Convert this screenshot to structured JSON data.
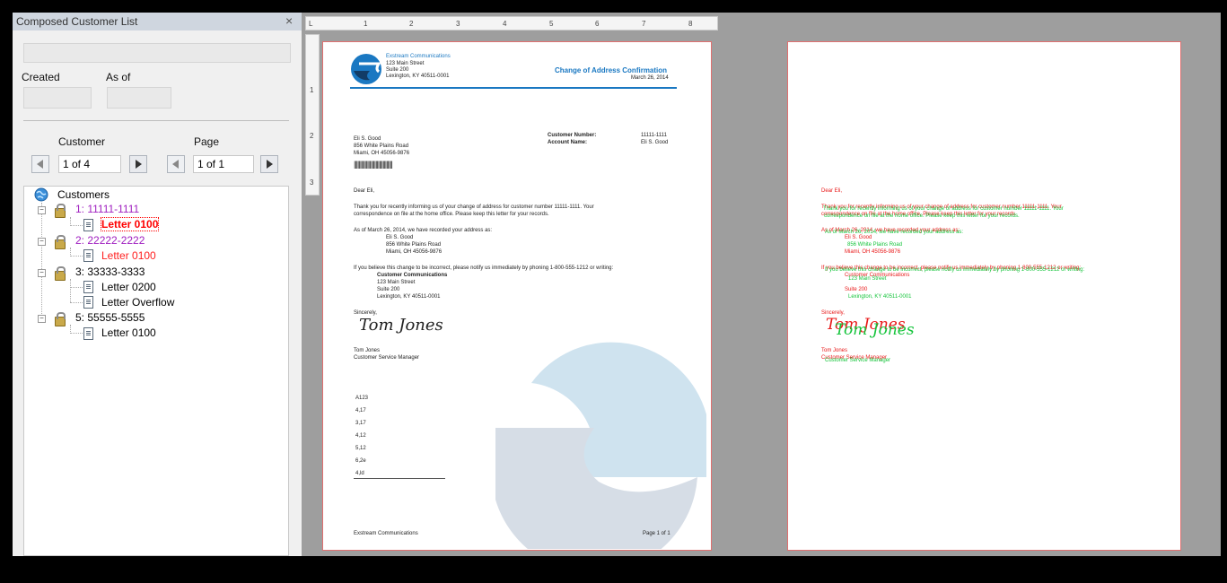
{
  "panel": {
    "title": "Composed Customer List",
    "close_glyph": "×",
    "created_label": "Created",
    "asof_label": "As of",
    "customer_label": "Customer",
    "page_label": "Page",
    "customer_value": "1 of 4",
    "page_value": "1 of 1"
  },
  "tree": {
    "root": "Customers",
    "nodes": [
      {
        "label": "1: 11111-1111",
        "children": [
          "Letter 0100"
        ]
      },
      {
        "label": "2: 22222-2222",
        "children": [
          "Letter 0100"
        ]
      },
      {
        "label": "3: 33333-3333",
        "children": [
          "Letter 0200",
          "Letter Overflow"
        ]
      },
      {
        "label": "5: 55555-5555",
        "children": [
          "Letter 0100"
        ]
      }
    ]
  },
  "ruler": {
    "corner": "L",
    "top_numbers": [
      "1",
      "2",
      "3",
      "4",
      "5",
      "6",
      "7",
      "8"
    ],
    "left_numbers": [
      "1",
      "2",
      "3"
    ]
  },
  "letter": {
    "company": "Exstream Communications",
    "addr1": "123 Main Street",
    "addr2": "Suite 200",
    "addr3": "Lexington, KY 40511-0001",
    "doc_title": "Change of Address Confirmation",
    "date": "March 26, 2014",
    "cust_no_label": "Customer Number:",
    "cust_no": "11111-1111",
    "acct_name_label": "Account Name:",
    "acct_name": "Eli S. Good",
    "recipient": "Eli S. Good",
    "rec_addr1": "856 White Plains Road",
    "rec_addr2": "Miami, OH 45056-9876",
    "barcode": "||||||||||||||||||||||||||||||||",
    "salutation": "Dear Eli,",
    "para1": "Thank you for recently informing us of your change of address for customer number 11111-1111. Your",
    "para1b": "correspondence on file at the home office. Please keep this letter for your records.",
    "asof_line": "As of March 26, 2014, we have recorded your address as:",
    "new1": "Eli S. Good",
    "new2": "856 White Plains Road",
    "new3": "Miami, OH 45056-9876",
    "contact_line": "If you believe this change to be incorrect, please notify us immediately by phoning 1-800-555-1212 or writing:",
    "c1": "Customer Communications",
    "c2": "123 Main Street",
    "c3": "Suite 200",
    "c4": "Lexington, KY 40511-0001",
    "closing": "Sincerely,",
    "signature": "Tom Jones",
    "signer": "Tom Jones",
    "signer_title": "Customer Service Manager",
    "codes": [
      "A123",
      "4,17",
      "3,17",
      "4,12",
      "5,12",
      "6,2e",
      "4,ld"
    ],
    "footer_left": "Exstream Communications",
    "footer_right": "Page 1 of 1"
  },
  "colors": {
    "selected_text": "#ff0000",
    "purple_text": "#a020c0",
    "brand_blue": "#1a78c2",
    "page_border": "#e07070"
  }
}
